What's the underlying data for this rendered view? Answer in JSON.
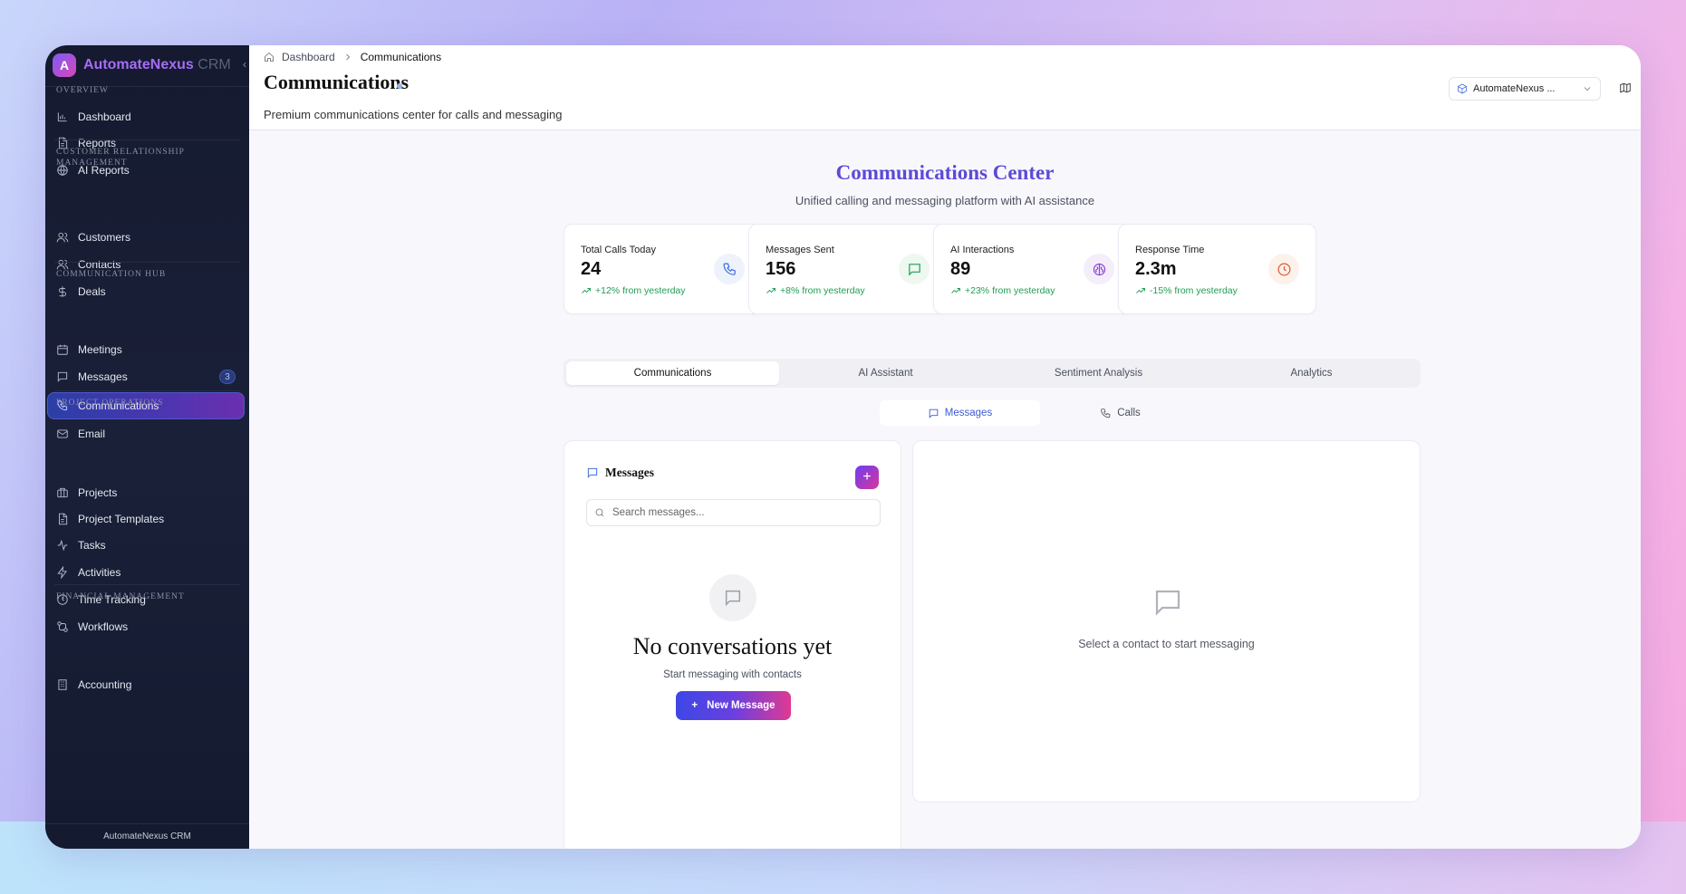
{
  "brand": {
    "logo_letter": "A",
    "name": "AutomateNexus",
    "suffix": "CRM"
  },
  "sidebar": {
    "sections": [
      {
        "title": "OVERVIEW",
        "items": [
          {
            "label": "Dashboard",
            "icon": "bar-chart-icon"
          },
          {
            "label": "Reports",
            "icon": "file-icon"
          },
          {
            "label": "AI Reports",
            "icon": "globe-icon"
          }
        ]
      },
      {
        "title": "CUSTOMER RELATIONSHIP MANAGEMENT",
        "items": [
          {
            "label": "Customers",
            "icon": "users-icon"
          },
          {
            "label": "Contacts",
            "icon": "users-icon"
          },
          {
            "label": "Deals",
            "icon": "dollar-icon"
          }
        ]
      },
      {
        "title": "COMMUNICATION HUB",
        "items": [
          {
            "label": "Meetings",
            "icon": "calendar-icon"
          },
          {
            "label": "Messages",
            "icon": "message-icon",
            "badge": "3"
          },
          {
            "label": "Communications",
            "icon": "phone-icon",
            "active": true
          },
          {
            "label": "Email",
            "icon": "mail-icon"
          }
        ]
      },
      {
        "title": "PROJECT OPERATIONS",
        "items": [
          {
            "label": "Projects",
            "icon": "briefcase-icon"
          },
          {
            "label": "Project Templates",
            "icon": "file-icon"
          },
          {
            "label": "Tasks",
            "icon": "activity-icon"
          },
          {
            "label": "Activities",
            "icon": "zap-icon"
          },
          {
            "label": "Time Tracking",
            "icon": "clock-icon"
          },
          {
            "label": "Workflows",
            "icon": "workflow-icon"
          }
        ]
      },
      {
        "title": "FINANCIAL MANAGEMENT",
        "items": [
          {
            "label": "Accounting",
            "icon": "building-icon"
          }
        ]
      }
    ],
    "footer": "AutomateNexus CRM"
  },
  "header": {
    "breadcrumb": {
      "home": "Dashboard",
      "current": "Communications"
    },
    "title": "Communications",
    "subtitle": "Premium communications center for calls and messaging",
    "org_select": "AutomateNexus ..."
  },
  "main": {
    "title": "Communications Center",
    "subtitle": "Unified calling and messaging platform with AI assistance",
    "stats": [
      {
        "label": "Total Calls Today",
        "value": "24",
        "change": "+12% from yesterday",
        "icon": "phone-icon",
        "color": "#3b6ee0",
        "bg": "#eef2fb"
      },
      {
        "label": "Messages Sent",
        "value": "156",
        "change": "+8% from yesterday",
        "icon": "message-icon",
        "color": "#1e9e55",
        "bg": "#eef8f1"
      },
      {
        "label": "AI Interactions",
        "value": "89",
        "change": "+23% from yesterday",
        "icon": "brain-icon",
        "color": "#8b3fd9",
        "bg": "#f4eefb"
      },
      {
        "label": "Response Time",
        "value": "2.3m",
        "change": "-15% from yesterday",
        "icon": "clock-icon",
        "color": "#e2552b",
        "bg": "#fdf1ec"
      }
    ],
    "tabs": [
      "Communications",
      "AI Assistant",
      "Sentiment Analysis",
      "Analytics"
    ],
    "subtabs": [
      "Messages",
      "Calls"
    ],
    "messages": {
      "title": "Messages",
      "add_label": "+",
      "search_placeholder": "Search messages...",
      "empty_title": "No conversations yet",
      "empty_sub": "Start messaging with contacts",
      "new_button": "New Message",
      "new_button_icon": "+"
    },
    "detail": {
      "empty_text": "Select a contact to start messaging"
    }
  }
}
